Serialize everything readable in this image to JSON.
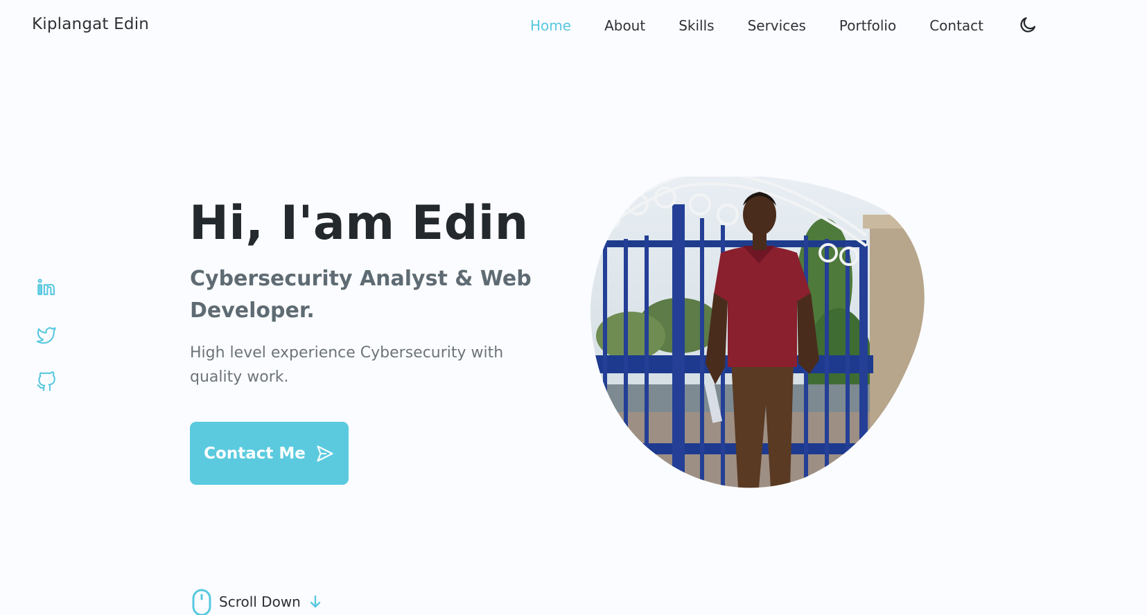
{
  "header": {
    "logo": "Kiplangat Edin",
    "nav": [
      "Home",
      "About",
      "Skills",
      "Services",
      "Portfolio",
      "Contact"
    ],
    "active_nav": "Home",
    "theme_icon": "moon-icon"
  },
  "social": {
    "icons": [
      "linkedin-icon",
      "twitter-icon",
      "github-icon"
    ]
  },
  "hero": {
    "title": "Hi, I'am Edin",
    "subtitle": "Cybersecurity Analyst & Web Developer.",
    "description": "High level experience Cybersecurity with quality work.",
    "button_label": "Contact Me",
    "button_icon": "send-icon"
  },
  "scroll": {
    "label": "Scroll Down",
    "icons": [
      "mouse-icon",
      "arrow-down-icon"
    ]
  },
  "colors": {
    "accent": "#5bcadf",
    "title": "#23292d",
    "subtitle": "#5f6b73",
    "text": "#6c7479",
    "background": "#fbfcff"
  }
}
